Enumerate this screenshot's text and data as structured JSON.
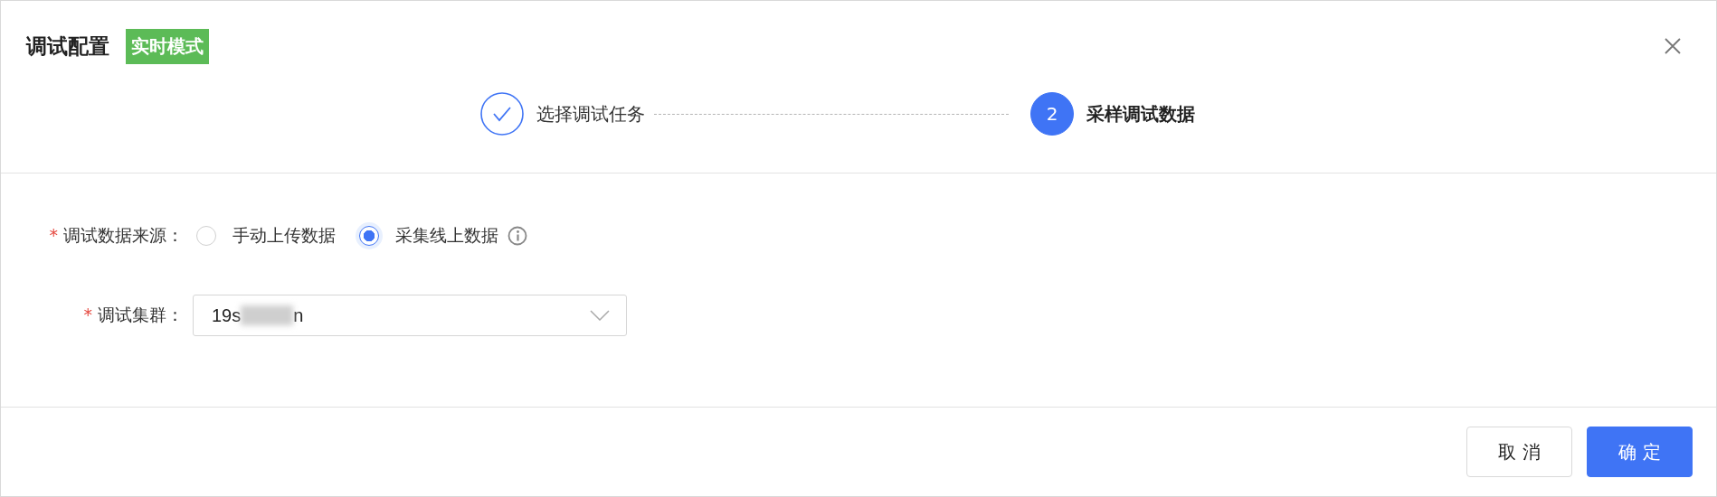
{
  "dialog": {
    "title": "调试配置",
    "badge": "实时模式"
  },
  "steps": [
    {
      "label": "选择调试任务",
      "kind": "done"
    },
    {
      "label": "采样调试数据",
      "kind": "current",
      "number": "2"
    }
  ],
  "form": {
    "source": {
      "label": "调试数据来源：",
      "required_mark": "*",
      "options": [
        {
          "label": "手动上传数据",
          "selected": false,
          "info": false
        },
        {
          "label": "采集线上数据",
          "selected": true,
          "info": true
        }
      ]
    },
    "cluster": {
      "label": "调试集群：",
      "required_mark": "*",
      "value_start": "19s",
      "value_end": "n",
      "redacted": true
    }
  },
  "buttons": [
    {
      "label": "取 消",
      "kind": "default"
    },
    {
      "label": "确 定",
      "kind": "primary"
    }
  ]
}
